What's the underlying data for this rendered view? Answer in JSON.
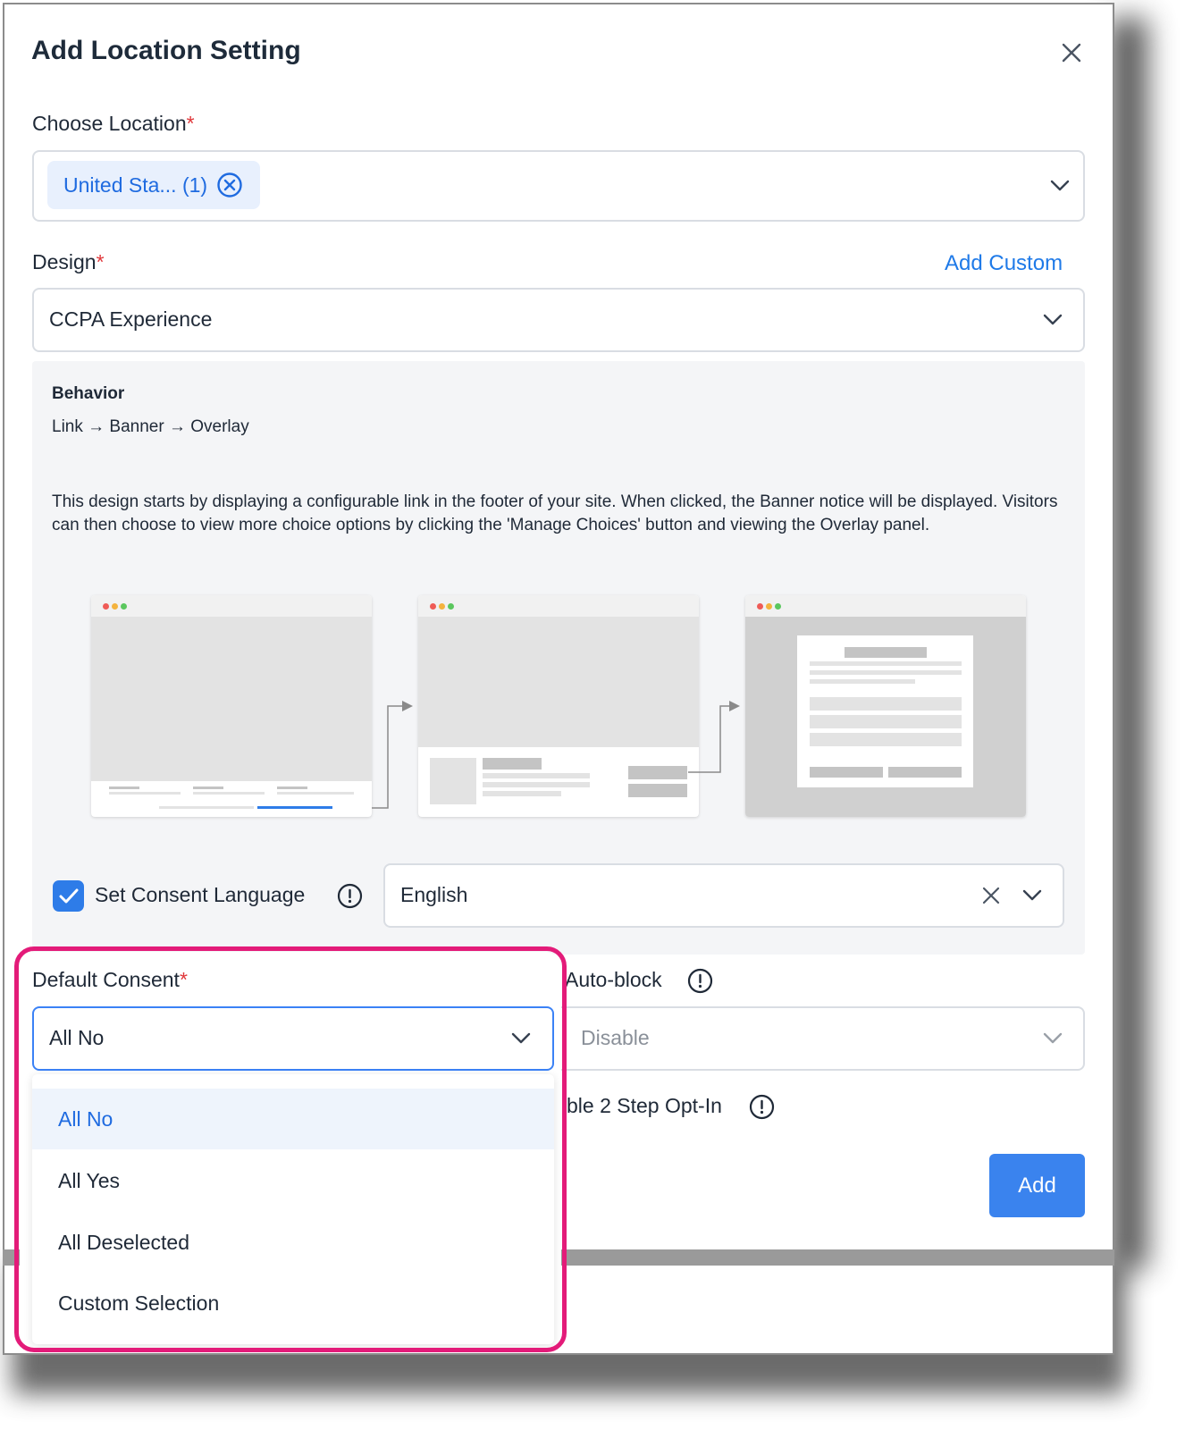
{
  "dialog": {
    "title": "Add Location Setting",
    "close_icon": "close-icon"
  },
  "location": {
    "label": "Choose Location",
    "required_mark": "*",
    "chip_label": "United Sta... (1)"
  },
  "design": {
    "label": "Design",
    "required_mark": "*",
    "add_custom_label": "Add Custom",
    "selected": "CCPA Experience"
  },
  "behavior": {
    "heading": "Behavior",
    "flow": "Link → Banner → Overlay",
    "description": "This design starts by displaying a configurable link in the footer of your site. When clicked, the Banner notice will be displayed. Visitors can then choose to view more choice options by clicking the 'Manage Choices' button and viewing the Overlay panel."
  },
  "consent_language": {
    "checked": true,
    "label": "Set Consent Language",
    "value": "English"
  },
  "default_consent": {
    "label": "Default Consent",
    "required_mark": "*",
    "selected": "All No",
    "options": [
      "All No",
      "All Yes",
      "All Deselected",
      "Custom Selection"
    ]
  },
  "auto_block": {
    "label": "Auto-block",
    "value": "Disable"
  },
  "two_step": {
    "label_partial": "ble 2 Step Opt-In"
  },
  "actions": {
    "add_label": "Add"
  },
  "colors": {
    "accent": "#2e7ce8",
    "highlight": "#e31b79",
    "required": "#e0373a"
  }
}
